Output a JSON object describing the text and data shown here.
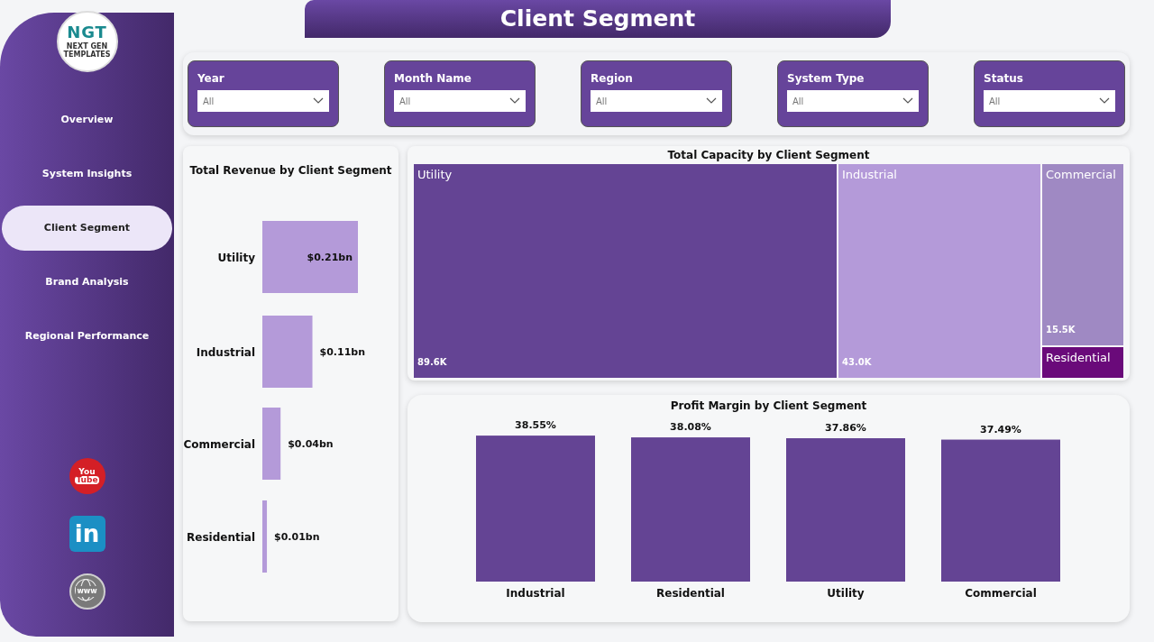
{
  "logo": {
    "mark": "NGT",
    "tagline": "NEXT GEN TEMPLATES"
  },
  "title": "Client Segment",
  "nav": [
    {
      "label": "Overview",
      "selected": false
    },
    {
      "label": "System Insights",
      "selected": false
    },
    {
      "label": "Client Segment",
      "selected": true
    },
    {
      "label": "Brand Analysis",
      "selected": false
    },
    {
      "label": "Regional Performance",
      "selected": false
    }
  ],
  "social": [
    {
      "kind": "youtube",
      "lines": [
        "You",
        "Tube"
      ]
    },
    {
      "kind": "linkedin",
      "lines": [
        "in"
      ]
    },
    {
      "kind": "web",
      "lines": [
        "www"
      ]
    }
  ],
  "filters": [
    {
      "label": "Year",
      "value": "All"
    },
    {
      "label": "Month Name",
      "value": "All"
    },
    {
      "label": "Region",
      "value": "All"
    },
    {
      "label": "System Type",
      "value": "All"
    },
    {
      "label": "Status",
      "value": "All"
    }
  ],
  "revenue": {
    "chart_data": {
      "type": "bar",
      "orientation": "horizontal",
      "title": "Total Revenue by Client Segment",
      "categories": [
        "Utility",
        "Industrial",
        "Commercial",
        "Residential"
      ],
      "values": [
        0.21,
        0.11,
        0.04,
        0.01
      ],
      "value_labels": [
        "$0.21bn",
        "$0.11bn",
        "$0.04bn",
        "$0.01bn"
      ]
    }
  },
  "capacity": {
    "title": "Total Capacity by Client Segment",
    "tiles": [
      {
        "label": "Utility",
        "value": "89.6K",
        "color": "#644494"
      },
      {
        "label": "Industrial",
        "value": "43.0K",
        "color": "#b49ad9"
      },
      {
        "label": "Commercial",
        "value": "15.5K",
        "color": "#9f89c3"
      },
      {
        "label": "Residential",
        "color": "#6a0a7a"
      }
    ]
  },
  "profit": {
    "chart_data": {
      "type": "bar",
      "title": "Profit Margin by Client Segment",
      "categories": [
        "Industrial",
        "Residential",
        "Utility",
        "Commercial"
      ],
      "values": [
        38.55,
        38.08,
        37.86,
        37.49
      ],
      "value_labels": [
        "38.55%",
        "38.08%",
        "37.86%",
        "37.49%"
      ]
    }
  }
}
